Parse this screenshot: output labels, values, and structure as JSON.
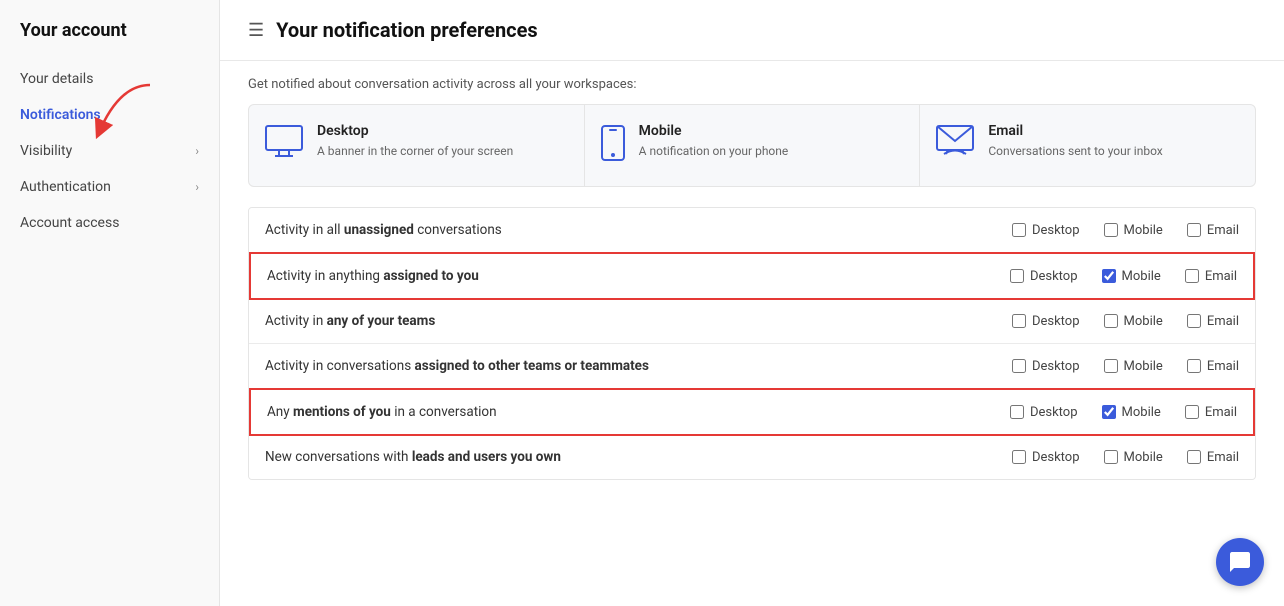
{
  "sidebar": {
    "title": "Your account",
    "items": [
      {
        "id": "your-details",
        "label": "Your details",
        "hasChevron": false,
        "active": false
      },
      {
        "id": "notifications",
        "label": "Notifications",
        "hasChevron": false,
        "active": true
      },
      {
        "id": "visibility",
        "label": "Visibility",
        "hasChevron": true,
        "active": false
      },
      {
        "id": "authentication",
        "label": "Authentication",
        "hasChevron": true,
        "active": false
      },
      {
        "id": "account-access",
        "label": "Account access",
        "hasChevron": false,
        "active": false
      }
    ]
  },
  "main": {
    "header_icon": "☰",
    "title": "Your notification preferences",
    "intro": "Get notified about conversation activity across all your workspaces:",
    "cards": [
      {
        "id": "desktop",
        "icon": "desktop",
        "title": "Desktop",
        "description": "A banner in the corner of your screen"
      },
      {
        "id": "mobile",
        "icon": "mobile",
        "title": "Mobile",
        "description": "A notification on your phone"
      },
      {
        "id": "email",
        "icon": "email",
        "title": "Email",
        "description": "Conversations sent to your inbox"
      }
    ],
    "rows": [
      {
        "id": "unassigned",
        "label_pre": "Activity in all ",
        "label_bold": "unassigned",
        "label_post": " conversations",
        "highlighted": false,
        "desktop": false,
        "mobile": false,
        "email": false
      },
      {
        "id": "assigned-to-you",
        "label_pre": "Activity in anything ",
        "label_bold": "assigned to you",
        "label_post": "",
        "highlighted": true,
        "desktop": false,
        "mobile": true,
        "email": false
      },
      {
        "id": "your-teams",
        "label_pre": "Activity in ",
        "label_bold": "any of your teams",
        "label_post": "",
        "highlighted": false,
        "desktop": false,
        "mobile": false,
        "email": false
      },
      {
        "id": "other-teams",
        "label_pre": "Activity in conversations ",
        "label_bold": "assigned to other teams or teammates",
        "label_post": "",
        "highlighted": false,
        "desktop": false,
        "mobile": false,
        "email": false
      },
      {
        "id": "mentions",
        "label_pre": "Any ",
        "label_bold": "mentions of you",
        "label_post": " in a conversation",
        "highlighted": true,
        "desktop": false,
        "mobile": true,
        "email": false
      },
      {
        "id": "leads-users",
        "label_pre": "New conversations with ",
        "label_bold": "leads and users you own",
        "label_post": "",
        "highlighted": false,
        "desktop": false,
        "mobile": false,
        "email": false
      }
    ],
    "checkbox_labels": {
      "desktop": "Desktop",
      "mobile": "Mobile",
      "email": "Email"
    }
  }
}
